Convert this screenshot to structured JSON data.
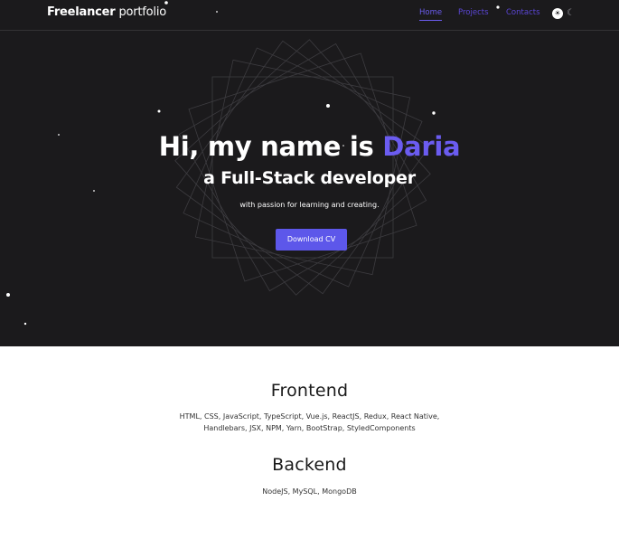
{
  "header": {
    "logo_bold": "Freelancer",
    "logo_rest": " portfolio",
    "nav": [
      {
        "label": "Home",
        "active": true
      },
      {
        "label": "Projects",
        "active": false
      },
      {
        "label": "Contacts",
        "active": false
      }
    ],
    "theme_icons": [
      "sun-icon",
      "moon-icon"
    ]
  },
  "hero": {
    "greeting": "Hi, my name is ",
    "name": "Daria",
    "role": "a Full-Stack developer",
    "tagline": "with passion for learning and creating.",
    "cv_button": "Download CV"
  },
  "skills": {
    "frontend": {
      "title": "Frontend",
      "line1": "HTML, CSS, JavaScript, TypeScript, Vue.js, ReactJS, Redux, React Native,",
      "line2": "Handlebars, JSX, NPM, Yarn, BootStrap, StyledComponents"
    },
    "backend": {
      "title": "Backend",
      "line1": "NodeJS, MySQL, MongoDB"
    }
  },
  "colors": {
    "hero_bg": "#1b1a1c",
    "accent": "#6b5cf0",
    "button": "#5d57ea",
    "nav_link": "#5b46d6"
  }
}
